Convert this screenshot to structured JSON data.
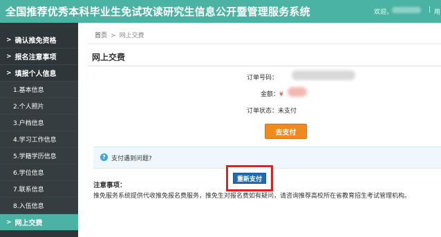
{
  "header": {
    "title": "全国推荐优秀本科毕业生免试攻读研究生信息公开暨管理服务系统",
    "welcome": "欢迎，",
    "separator": "|",
    "more": "用"
  },
  "sidebar": {
    "items": [
      {
        "label": "确认推免资格",
        "type": "section"
      },
      {
        "label": "报名注意事项",
        "type": "section"
      },
      {
        "label": "填报个人信息",
        "type": "section"
      },
      {
        "label": "1.基本信息",
        "type": "sub"
      },
      {
        "label": "2.个人照片",
        "type": "sub"
      },
      {
        "label": "3.户档信息",
        "type": "sub"
      },
      {
        "label": "4.学习工作信息",
        "type": "sub"
      },
      {
        "label": "5.学籍学历信息",
        "type": "sub"
      },
      {
        "label": "6.学位信息",
        "type": "sub"
      },
      {
        "label": "7.联系信息",
        "type": "sub"
      },
      {
        "label": "8.入伍信息",
        "type": "sub"
      },
      {
        "label": "网上交费",
        "type": "section",
        "active": true
      }
    ],
    "chevron": ">"
  },
  "breadcrumb": {
    "home": "首页",
    "separator": ">",
    "current": "网上交费"
  },
  "page": {
    "title": "网上交费"
  },
  "order": {
    "number_label": "订单号码：",
    "amount_label": "金额：",
    "currency_symbol": "¥",
    "status_label": "订单状态：",
    "status_value": "未支付"
  },
  "actions": {
    "pay_label": "去支付",
    "help_icon": "?",
    "help_text": "支付遇到问题?",
    "repay_label": "重新支付"
  },
  "notice": {
    "title": "注意事项：",
    "text": "推免服务系统提供代收推免报名费服务，推免生对报名费如有疑问，请咨询推荐高校所在省教育招生考试管理机构。"
  },
  "colors": {
    "header_bg": "#4ab3a3",
    "sidebar_bg": "#2e3639",
    "pay_button": "#f08a1c",
    "repay_button": "#1f6db0",
    "highlight_box": "#e02020"
  }
}
